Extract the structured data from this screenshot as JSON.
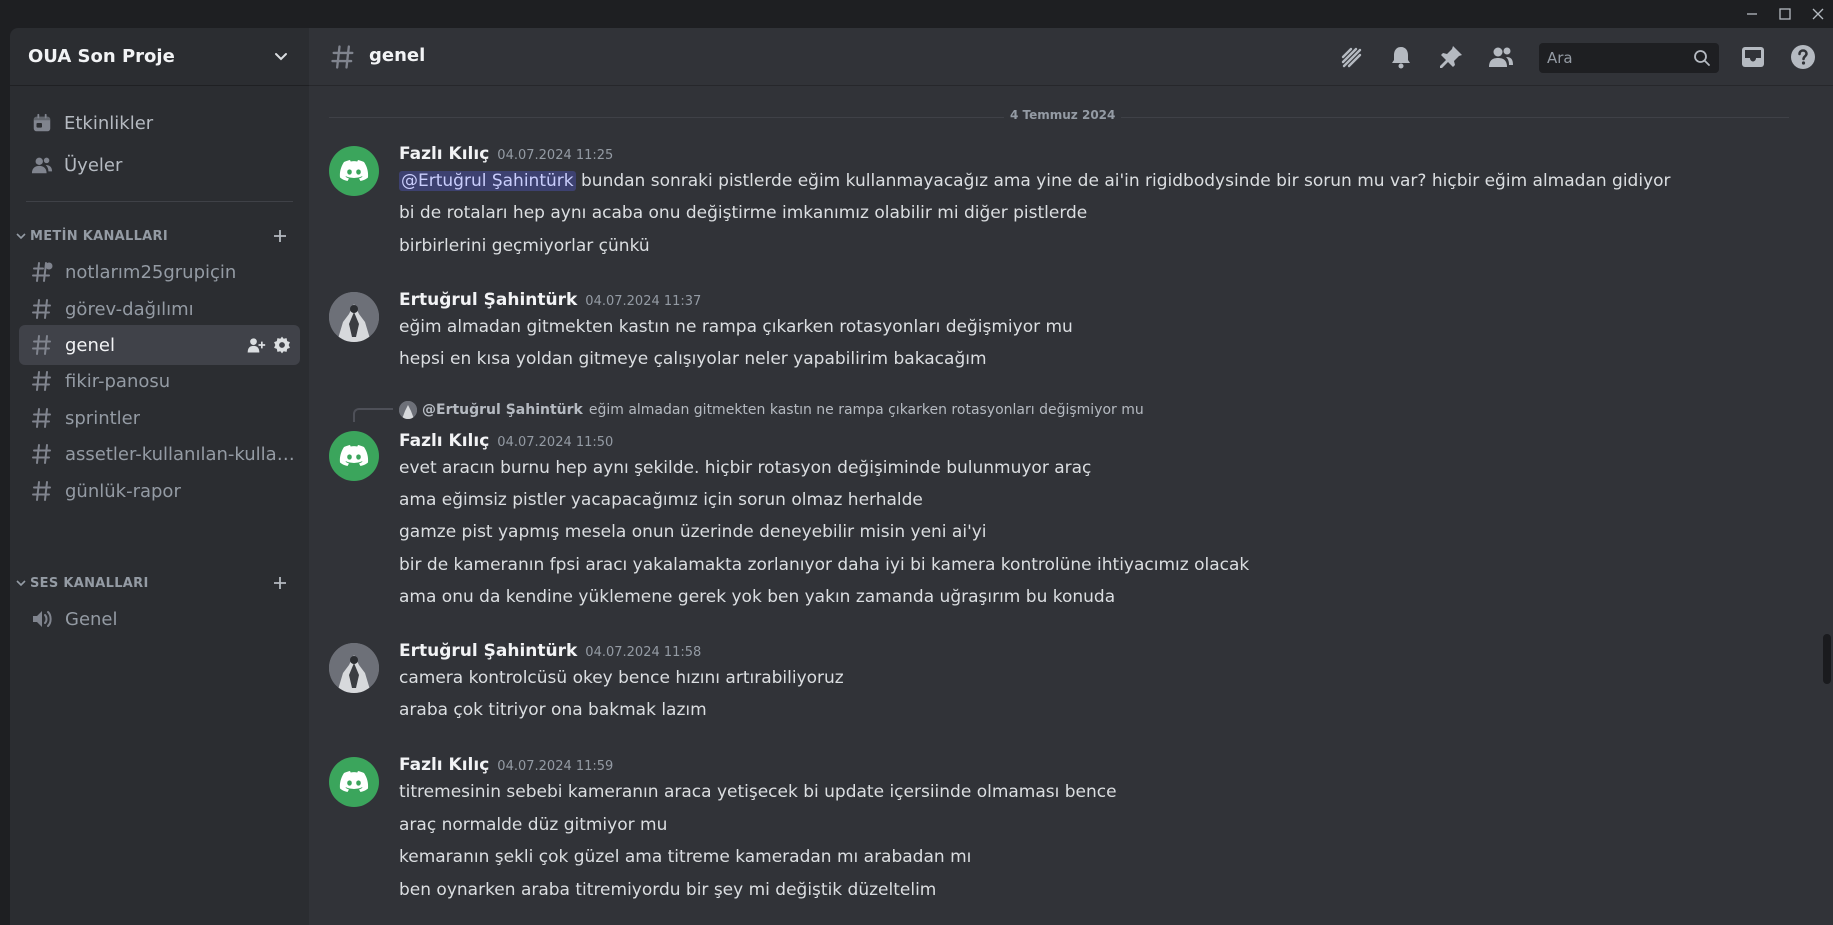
{
  "window": {
    "minimize": "minimize",
    "maximize": "maximize",
    "close": "close"
  },
  "server": {
    "name": "OUA Son Proje"
  },
  "nav": [
    {
      "label": "Etkinlikler",
      "icon": "calendar-icon"
    },
    {
      "label": "Üyeler",
      "icon": "members-icon"
    }
  ],
  "categories": {
    "text": "METİN KANALLARI",
    "voice": "SES KANALLARI"
  },
  "text_channels": [
    {
      "name": "notlarım25grupiçin"
    },
    {
      "name": "görev-dağılımı"
    },
    {
      "name": "genel",
      "active": true
    },
    {
      "name": "fikir-panosu"
    },
    {
      "name": "sprintler"
    },
    {
      "name": "assetler-kullanılan-kullanılacak"
    },
    {
      "name": "günlük-rapor"
    }
  ],
  "voice_channels": [
    {
      "name": "Genel"
    }
  ],
  "header": {
    "channel": "genel",
    "search_placeholder": "Ara"
  },
  "date_divider": "4 Temmuz 2024",
  "messages": [
    {
      "author": "Fazlı Kılıç",
      "time": "04.07.2024 11:25",
      "mention": "@Ertuğrul Şahintürk",
      "lines": [
        " bundan sonraki pistlerde eğim kullanmayacağız ama yine de ai'in rigidbodysinde bir sorun mu var? hiçbir eğim almadan gidiyor",
        "bi de rotaları hep aynı acaba onu değiştirme imkanımız olabilir mi diğer pistlerde",
        "birbirlerini geçmiyorlar çünkü"
      ]
    },
    {
      "author": "Ertuğrul Şahintürk",
      "time": "04.07.2024 11:37",
      "lines": [
        "eğim almadan gitmekten kastın ne rampa çıkarken rotasyonları değişmiyor mu",
        "hepsi en kısa yoldan gitmeye çalışıyolar neler yapabilirim bakacağım"
      ]
    },
    {
      "author": "Fazlı Kılıç",
      "time": "04.07.2024 11:50",
      "reply_user": "@Ertuğrul Şahintürk",
      "reply_text": "eğim almadan gitmekten kastın ne rampa çıkarken rotasyonları değişmiyor mu",
      "lines": [
        "evet aracın burnu hep aynı şekilde. hiçbir rotasyon değişiminde bulunmuyor araç",
        "ama eğimsiz pistler yacapacağımız için sorun olmaz herhalde",
        "gamze pist yapmış mesela onun üzerinde deneyebilir misin yeni ai'yi",
        "bir de kameranın fpsi aracı yakalamakta zorlanıyor daha iyi bi kamera kontrolüne ihtiyacımız olacak",
        "ama onu da kendine yüklemene gerek yok ben yakın zamanda uğraşırım bu konuda"
      ]
    },
    {
      "author": "Ertuğrul Şahintürk",
      "time": "04.07.2024 11:58",
      "lines": [
        "camera kontrolcüsü okey bence hızını artırabiliyoruz",
        "araba çok titriyor ona bakmak lazım"
      ]
    },
    {
      "author": "Fazlı Kılıç",
      "time": "04.07.2024 11:59",
      "lines": [
        "titremesinin sebebi kameranın araca yetişecek bi update içersiinde olmaması bence",
        "araç normalde düz gitmiyor mu",
        "kemaranın şekli çok güzel ama titreme kameradan mı arabadan mı",
        "ben oynarken araba titremiyordu bir şey mi değiştik düzeltelim"
      ]
    }
  ]
}
